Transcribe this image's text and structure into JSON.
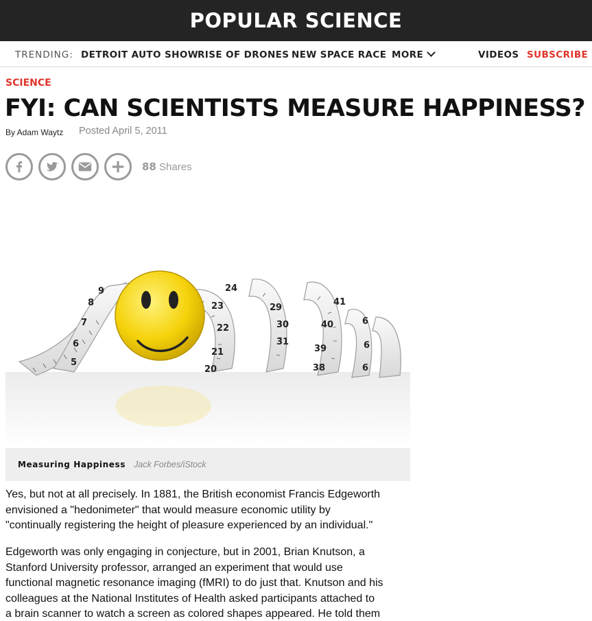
{
  "site": {
    "logo": "POPULAR SCIENCE"
  },
  "nav": {
    "trending_label": "TRENDING:",
    "items": [
      "DETROIT AUTO SHOW",
      "RISE OF DRONES",
      "NEW SPACE RACE",
      "MORE"
    ],
    "videos": "VIDEOS",
    "subscribe": "SUBSCRIBE"
  },
  "article": {
    "section": "SCIENCE",
    "title": "FYI: CAN SCIENTISTS MEASURE HAPPINESS?",
    "byline": "By Adam Waytz",
    "posted": "Posted April 5, 2011",
    "shares_count": "88",
    "shares_label": "Shares",
    "image": {
      "alt": "Smiley face wrapped in tape measure",
      "tape_numbers": [
        "5",
        "6",
        "7",
        "8",
        "9",
        "20",
        "21",
        "22",
        "23",
        "24",
        "29",
        "30",
        "31",
        "38",
        "39",
        "40",
        "41",
        "6",
        "6",
        "6"
      ],
      "caption_title": "Measuring Happiness",
      "caption_credit": "Jack Forbes/iStock"
    },
    "paragraphs": [
      [
        "Yes, but not at all precisely. In 1881, the British economist Francis Edgeworth",
        "envisioned a \"hedonimeter\" that would measure economic utility by",
        "\"continually registering the height of pleasure experienced by an individual.\""
      ],
      [
        "Edgeworth was only engaging in conjecture, but in 2001, Brian Knutson, a",
        "Stanford University professor, arranged an experiment that would use",
        "functional magnetic resonance imaging (fMRI) to do just that. Knutson and his",
        "colleagues at the National Institutes of Health asked participants attached to",
        "a brain scanner to watch a screen as colored shapes appeared. He told them"
      ]
    ]
  },
  "colors": {
    "accent": "#e0352b",
    "header_bg": "#242424",
    "icon_gray": "#9a9a9a",
    "smiley": "#f5d20a"
  }
}
